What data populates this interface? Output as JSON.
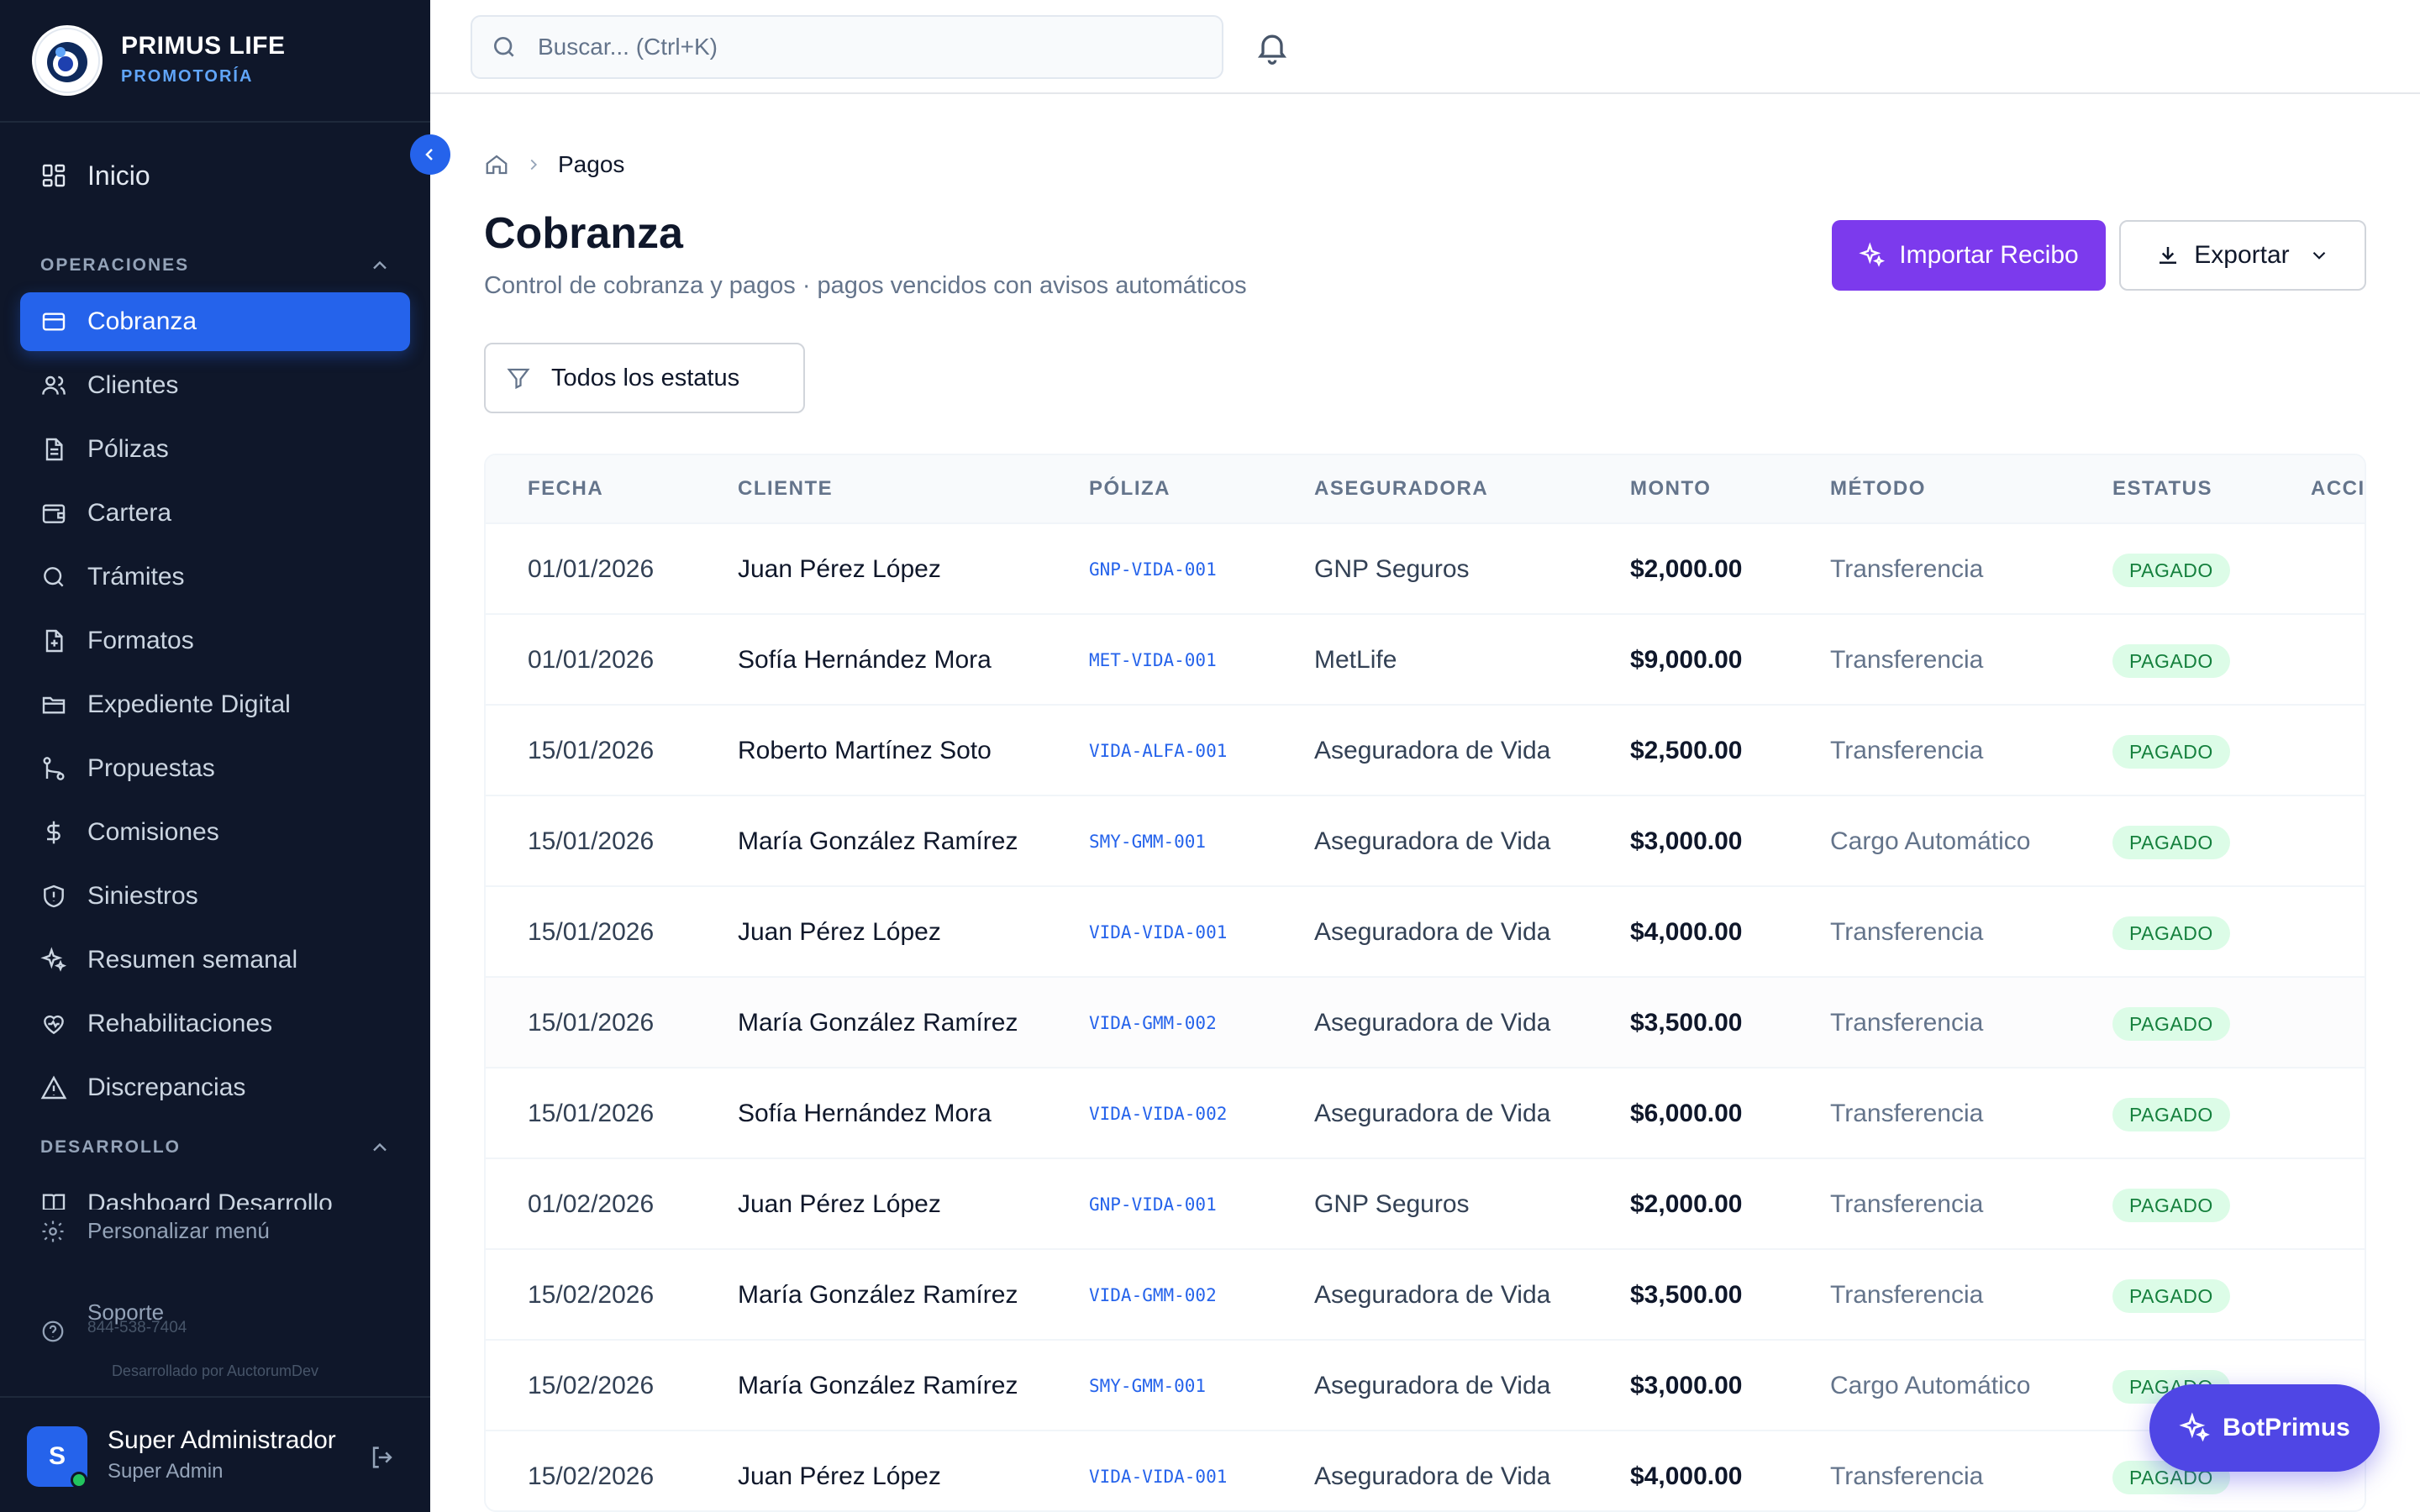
{
  "brand": {
    "name": "PRIMUS LIFE",
    "subtitle": "PROMOTORÍA"
  },
  "sidebar": {
    "home": "Inicio",
    "section_ops": "OPERACIONES",
    "items": [
      {
        "label": "Cobranza",
        "icon": "credit-card-icon",
        "active": true
      },
      {
        "label": "Clientes",
        "icon": "users-icon"
      },
      {
        "label": "Pólizas",
        "icon": "document-icon"
      },
      {
        "label": "Cartera",
        "icon": "wallet-icon"
      },
      {
        "label": "Trámites",
        "icon": "search-icon"
      },
      {
        "label": "Formatos",
        "icon": "file-plus-icon"
      },
      {
        "label": "Expediente Digital",
        "icon": "folder-icon"
      },
      {
        "label": "Propuestas",
        "icon": "git-branch-icon"
      },
      {
        "label": "Comisiones",
        "icon": "dollar-icon"
      },
      {
        "label": "Siniestros",
        "icon": "shield-icon"
      },
      {
        "label": "Resumen semanal",
        "icon": "sparkles-icon"
      },
      {
        "label": "Rehabilitaciones",
        "icon": "heart-icon"
      },
      {
        "label": "Discrepancias",
        "icon": "alert-triangle-icon"
      }
    ],
    "section_dev": "DESARROLLO",
    "dev_item": "Dashboard Desarrollo",
    "customize": "Personalizar menú",
    "support": "Soporte",
    "support_phone": "844-538-7404",
    "credit": "Desarrollado por AuctorumDev"
  },
  "user": {
    "initial": "S",
    "name": "Super Administrador",
    "role": "Super Admin"
  },
  "search": {
    "placeholder": "Buscar... (Ctrl+K)"
  },
  "breadcrumb": {
    "current": "Pagos"
  },
  "page": {
    "title": "Cobranza",
    "subtitle": "Control de cobranza y pagos · pagos vencidos con avisos automáticos"
  },
  "actions": {
    "import": "Importar Recibo",
    "export": "Exportar"
  },
  "filter": {
    "status": "Todos los estatus"
  },
  "table": {
    "headers": [
      "FECHA",
      "CLIENTE",
      "PÓLIZA",
      "ASEGURADORA",
      "MONTO",
      "MÉTODO",
      "ESTATUS",
      "ACCI"
    ],
    "rows": [
      {
        "fecha": "01/01/2026",
        "cliente": "Juan Pérez López",
        "poliza": "GNP-VIDA-001",
        "aseguradora": "GNP Seguros",
        "monto": "$2,000.00",
        "metodo": "Transferencia",
        "estatus": "PAGADO"
      },
      {
        "fecha": "01/01/2026",
        "cliente": "Sofía Hernández Mora",
        "poliza": "MET-VIDA-001",
        "aseguradora": "MetLife",
        "monto": "$9,000.00",
        "metodo": "Transferencia",
        "estatus": "PAGADO"
      },
      {
        "fecha": "15/01/2026",
        "cliente": "Roberto Martínez Soto",
        "poliza": "VIDA-ALFA-001",
        "aseguradora": "Aseguradora de Vida",
        "monto": "$2,500.00",
        "metodo": "Transferencia",
        "estatus": "PAGADO"
      },
      {
        "fecha": "15/01/2026",
        "cliente": "María González Ramírez",
        "poliza": "SMY-GMM-001",
        "aseguradora": "Aseguradora de Vida",
        "monto": "$3,000.00",
        "metodo": "Cargo Automático",
        "estatus": "PAGADO"
      },
      {
        "fecha": "15/01/2026",
        "cliente": "Juan Pérez López",
        "poliza": "VIDA-VIDA-001",
        "aseguradora": "Aseguradora de Vida",
        "monto": "$4,000.00",
        "metodo": "Transferencia",
        "estatus": "PAGADO"
      },
      {
        "fecha": "15/01/2026",
        "cliente": "María González Ramírez",
        "poliza": "VIDA-GMM-002",
        "aseguradora": "Aseguradora de Vida",
        "monto": "$3,500.00",
        "metodo": "Transferencia",
        "estatus": "PAGADO"
      },
      {
        "fecha": "15/01/2026",
        "cliente": "Sofía Hernández Mora",
        "poliza": "VIDA-VIDA-002",
        "aseguradora": "Aseguradora de Vida",
        "monto": "$6,000.00",
        "metodo": "Transferencia",
        "estatus": "PAGADO"
      },
      {
        "fecha": "01/02/2026",
        "cliente": "Juan Pérez López",
        "poliza": "GNP-VIDA-001",
        "aseguradora": "GNP Seguros",
        "monto": "$2,000.00",
        "metodo": "Transferencia",
        "estatus": "PAGADO"
      },
      {
        "fecha": "15/02/2026",
        "cliente": "María González Ramírez",
        "poliza": "VIDA-GMM-002",
        "aseguradora": "Aseguradora de Vida",
        "monto": "$3,500.00",
        "metodo": "Transferencia",
        "estatus": "PAGADO"
      },
      {
        "fecha": "15/02/2026",
        "cliente": "María González Ramírez",
        "poliza": "SMY-GMM-001",
        "aseguradora": "Aseguradora de Vida",
        "monto": "$3,000.00",
        "metodo": "Cargo Automático",
        "estatus": "PAGADO"
      },
      {
        "fecha": "15/02/2026",
        "cliente": "Juan Pérez López",
        "poliza": "VIDA-VIDA-001",
        "aseguradora": "Aseguradora de Vida",
        "monto": "$4,000.00",
        "metodo": "Transferencia",
        "estatus": "PAGADO"
      }
    ]
  },
  "bot": {
    "label": "BotPrimus"
  },
  "colors": {
    "sidebar_bg": "#0f172a",
    "accent": "#2563eb",
    "import_btn": "#7c3aed",
    "bot_btn": "#4f46e5",
    "badge_bg": "#dcfce7",
    "badge_text": "#15803d"
  }
}
